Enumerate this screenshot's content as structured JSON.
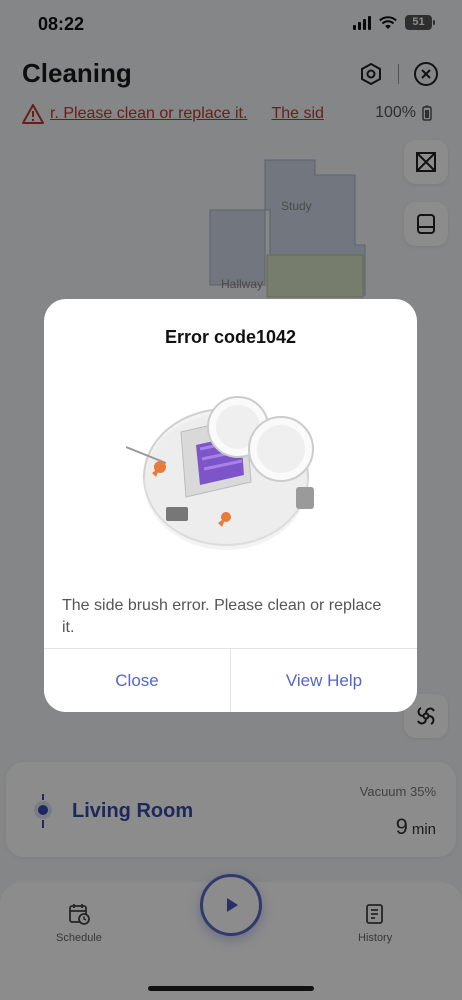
{
  "status_bar": {
    "time": "08:22",
    "battery": "51"
  },
  "header": {
    "title": "Cleaning",
    "robot_battery": "100%"
  },
  "error_ticker": {
    "text_1": "r. Please clean or replace it.",
    "text_2": "The sid"
  },
  "map": {
    "rooms": [
      "Study",
      "Hallway"
    ]
  },
  "room_card": {
    "room_name": "Living Room",
    "mode": "Vacuum 35%",
    "duration_value": "9",
    "duration_unit": "min"
  },
  "bottom_nav": {
    "schedule_label": "Schedule",
    "history_label": "History"
  },
  "modal": {
    "title": "Error code1042",
    "message": "The side brush error. Please clean or replace it.",
    "close_label": "Close",
    "help_label": "View Help"
  },
  "colors": {
    "accent": "#5566c6",
    "error": "#c0392b",
    "room_name": "#3a4aa8"
  },
  "icons": [
    "signal-icon",
    "wifi-icon",
    "battery-icon",
    "settings-hex-icon",
    "close-circle-icon",
    "warning-icon",
    "battery-small-icon",
    "map-edit-icon",
    "mop-icon",
    "suction-fan-icon",
    "play-icon",
    "schedule-icon",
    "history-icon",
    "robot-location-icon"
  ]
}
